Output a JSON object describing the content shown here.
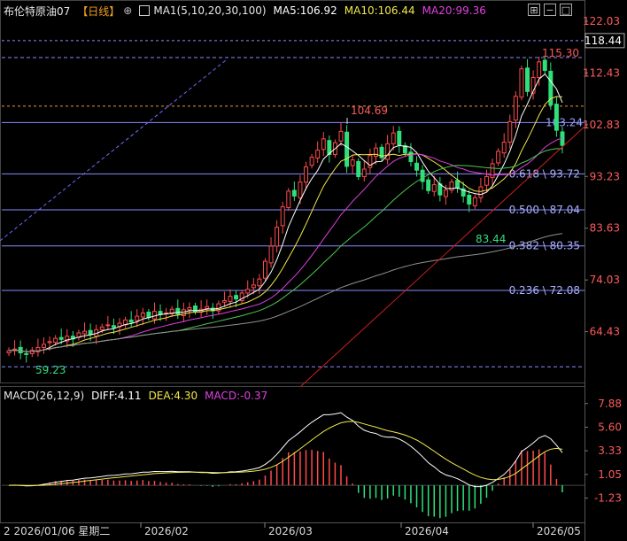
{
  "header": {
    "instrument": "布伦特原油07",
    "period": "【日线】",
    "add_symbol": "⊕",
    "ma_params": "MA1(5,10,20,30,100)",
    "ma5": "MA5:106.92",
    "ma10": "MA10:106.44",
    "ma20": "MA20:99.36"
  },
  "macd_header": {
    "params": "MACD(26,12,9)",
    "diff": "DIFF:4.11",
    "dea": "DEA:4.30",
    "macd": "MACD:-0.37"
  },
  "colors": {
    "up": "#ff4a4a",
    "down": "#2fe07a",
    "ma5": "#ffffff",
    "ma10": "#f3e84a",
    "ma20": "#e040e0",
    "ma30": "#4ec84e",
    "ma100": "#909090",
    "fib": "#8a8aff",
    "trend": "#cc1f1f",
    "label_red": "#ff5a5a",
    "label_green": "#2fe07a"
  },
  "chart_data": {
    "type": "candlestick",
    "main": {
      "y_ticks": [
        "122.03",
        "112.43",
        "102.83",
        "93.23",
        "83.63",
        "74.03",
        "64.43"
      ],
      "y_current": "118.44",
      "ylim": [
        55.0,
        122.03
      ],
      "x_ticks": [
        "2 2026/01/06 星期二",
        "2026/02",
        "2026/03",
        "2026/04",
        "2026/05"
      ],
      "fib_levels": [
        {
          "ratio": "0.618",
          "price": "93.72",
          "label": "0.618 \\ 93.72"
        },
        {
          "ratio": "0.500",
          "price": "87.04",
          "label": "0.500 \\ 87.04"
        },
        {
          "ratio": "0.382",
          "price": "80.35",
          "label": "0.382 \\ 80.35"
        },
        {
          "ratio": "0.236",
          "price": "72.08",
          "label": "0.236 \\ 72.08"
        }
      ],
      "annotations": [
        {
          "text": "115.30",
          "kind": "high"
        },
        {
          "text": "104.69",
          "kind": "high"
        },
        {
          "text": "103.24",
          "kind": "level"
        },
        {
          "text": "83.44",
          "kind": "low"
        },
        {
          "text": "59.23",
          "kind": "low"
        }
      ],
      "closes": [
        60.9,
        61.2,
        60.5,
        60.2,
        61.0,
        61.5,
        62.1,
        62.6,
        63.2,
        63.0,
        63.6,
        63.1,
        64.2,
        64.5,
        63.9,
        64.8,
        65.3,
        65.7,
        65.2,
        66.0,
        66.6,
        66.2,
        67.3,
        67.9,
        67.1,
        68.2,
        67.6,
        67.9,
        68.6,
        67.7,
        68.5,
        68.9,
        68.2,
        68.6,
        69.1,
        68.3,
        69.6,
        70.2,
        71.0,
        70.5,
        71.6,
        72.3,
        73.1,
        74.2,
        77.5,
        80.3,
        83.8,
        87.6,
        90.5,
        89.6,
        92.2,
        95.0,
        96.8,
        98.1,
        100.2,
        97.3,
        99.5,
        101.6,
        95.1,
        96.3,
        93.2,
        94.6,
        97.1,
        98.5,
        96.7,
        99.3,
        101.3,
        99.1,
        97.6,
        96.0,
        94.4,
        92.3,
        90.6,
        91.7,
        89.8,
        90.7,
        92.2,
        91.1,
        89.6,
        88.1,
        89.3,
        91.3,
        93.2,
        95.6,
        97.9,
        99.6,
        103.4,
        108.1,
        113.2,
        109.0,
        111.6,
        114.5,
        112.9,
        106.5,
        101.8,
        99.0
      ]
    },
    "macd": {
      "y_ticks": [
        "7.88",
        "5.60",
        "3.33",
        "1.05",
        "-1.23"
      ],
      "ylim": [
        -3.4,
        8.2
      ],
      "diff": 4.11,
      "dea": 4.3,
      "macd": -0.37
    }
  }
}
